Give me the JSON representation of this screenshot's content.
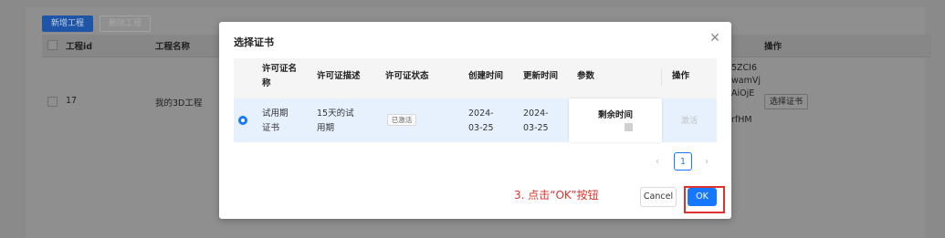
{
  "background": {
    "toolbar": {
      "add_label": "新增工程",
      "delete_label": "删除工程"
    },
    "table": {
      "headers": {
        "id": "工程id",
        "name": "工程名称",
        "ops": "操作"
      },
      "row": {
        "id": "17",
        "name": "我的3D工程",
        "frag1": "5ZCI6",
        "frag2": "wamVj",
        "frag3": "AiOjE",
        "frag4": "rfHM",
        "select_btn": "选择证书"
      }
    }
  },
  "modal": {
    "title": "选择证书",
    "close_icon": "close-icon",
    "columns": {
      "name": "许可证名称",
      "desc": "许可证描述",
      "status": "许可证状态",
      "created": "创建时间",
      "updated": "更新时间",
      "params": "参数",
      "ops": "操作"
    },
    "row": {
      "selected": true,
      "name": "试用期证书",
      "desc": "15天的试用期",
      "status": "已激活",
      "created": "2024-03-25",
      "updated": "2024-03-25",
      "param_title": "剩余时间",
      "action": "激活"
    },
    "pagination": {
      "prev": "‹",
      "current": "1",
      "next": "›"
    },
    "footer": {
      "cancel_label": "Cancel",
      "ok_label": "OK"
    },
    "annotation": "3. 点击“OK”按钮"
  },
  "colors": {
    "primary": "#1677ff",
    "annotation": "#e0322c",
    "selected_row": "#e6f1fd"
  }
}
